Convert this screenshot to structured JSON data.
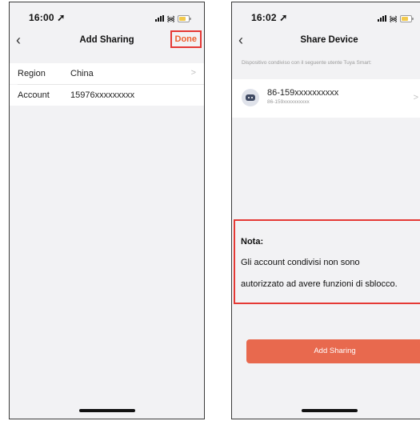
{
  "left_screen": {
    "status": {
      "time": "16:00",
      "location_icon": "location-arrow-icon"
    },
    "nav": {
      "title": "Add Sharing",
      "back_icon": "chevron-left-icon",
      "done_label": "Done"
    },
    "rows": [
      {
        "label": "Region",
        "value": "China",
        "chevron": ">"
      },
      {
        "label": "Account",
        "value": "15976xxxxxxxxx"
      }
    ]
  },
  "right_screen": {
    "status": {
      "time": "16:02",
      "location_icon": "location-arrow-icon"
    },
    "nav": {
      "title": "Share Device",
      "back_icon": "chevron-left-icon"
    },
    "caption": "Dispositivo condiviso con il seguente utente Tuya Smart:",
    "device": {
      "name": "86-159xxxxxxxxxx",
      "subtitle": "86-159xxxxxxxxxx",
      "chevron": ">"
    },
    "note": {
      "title": "Nota:",
      "line1": "Gli account condivisi non sono",
      "line2": "autorizzato ad avere funzioni di sblocco."
    },
    "add_button_label": "Add Sharing"
  },
  "colors": {
    "accent": "#e8694e",
    "highlight_border": "#e53935",
    "background": "#f2f2f4"
  }
}
